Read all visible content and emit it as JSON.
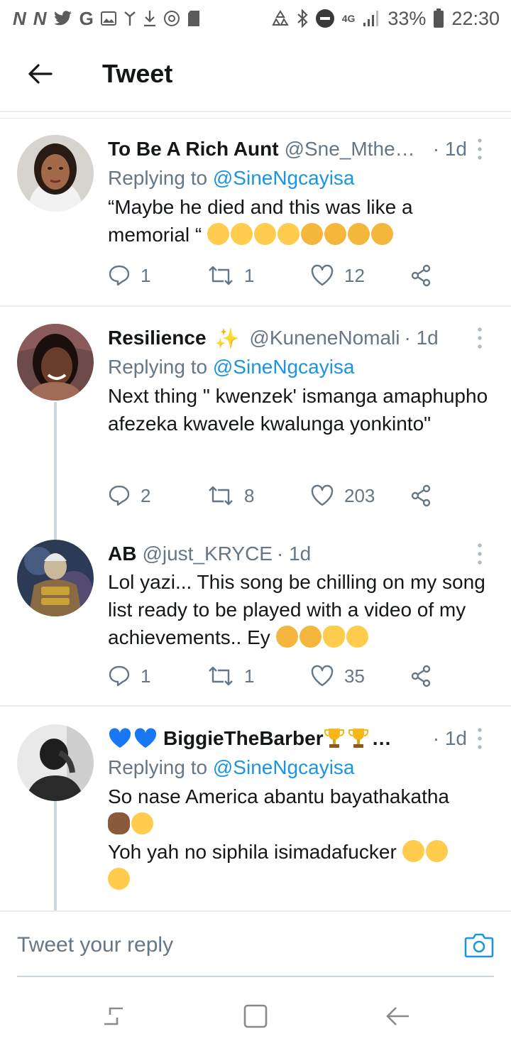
{
  "status_bar": {
    "left_icons": [
      "N",
      "N",
      "twitter-icon",
      "G",
      "gallery-icon",
      "antenna-icon",
      "download-icon",
      "record-icon",
      "sd-card-icon"
    ],
    "battery": "33%",
    "time": "22:30",
    "network": "4G"
  },
  "header": {
    "title": "Tweet"
  },
  "tweets": [
    {
      "name": "To Be A Rich Aunt",
      "handle": "@Sne_Mthe…",
      "time": "· 1d",
      "replying_prefix": "Replying to ",
      "replying_to": "@SineNgcayisa",
      "text": "“Maybe he died and this was like a memorial “",
      "emojis": [
        "grinning-sweat",
        "grinning-sweat",
        "grinning-sweat",
        "grinning-sweat",
        "loudly-crying",
        "loudly-crying",
        "loudly-crying",
        "loudly-crying"
      ],
      "replies": "1",
      "retweets": "1",
      "likes": "12"
    },
    {
      "name": "Resilience",
      "name_badge": "✨",
      "handle": "@KuneneNomali",
      "time": "· 1d",
      "replying_prefix": "Replying to ",
      "replying_to": "@SineNgcayisa",
      "text": "Next thing \" kwenzek' ismanga amaphupho afezeka kwavele kwalunga yonkinto\"",
      "replies": "2",
      "retweets": "8",
      "likes": "203"
    },
    {
      "name": "AB",
      "handle": "@just_KRYCE",
      "time": "· 1d",
      "text": "Lol yazi... This song be chilling on  my song list ready to be played with a video of my achievements.. Ey",
      "emojis": [
        "loudly-crying",
        "loudly-crying",
        "ok-hand",
        "grinning-sweat"
      ],
      "replies": "1",
      "retweets": "1",
      "likes": "35"
    },
    {
      "name": "BiggieTheBarber",
      "name_suffix": "…",
      "handle": "",
      "time": "· 1d",
      "replying_prefix": "Replying to ",
      "replying_to": "@SineNgcayisa",
      "text_line1": "So nase America abantu bayathakatha",
      "text_line2": "Yoh yah no siphila isimadafucker"
    }
  ],
  "composer": {
    "placeholder": "Tweet your reply"
  },
  "colors": {
    "accent": "#1b95e0",
    "muted": "#657786",
    "divider": "#e6ecf0",
    "emoji_yellow": "#ffcc4d",
    "heart_blue": "#1877f2"
  }
}
